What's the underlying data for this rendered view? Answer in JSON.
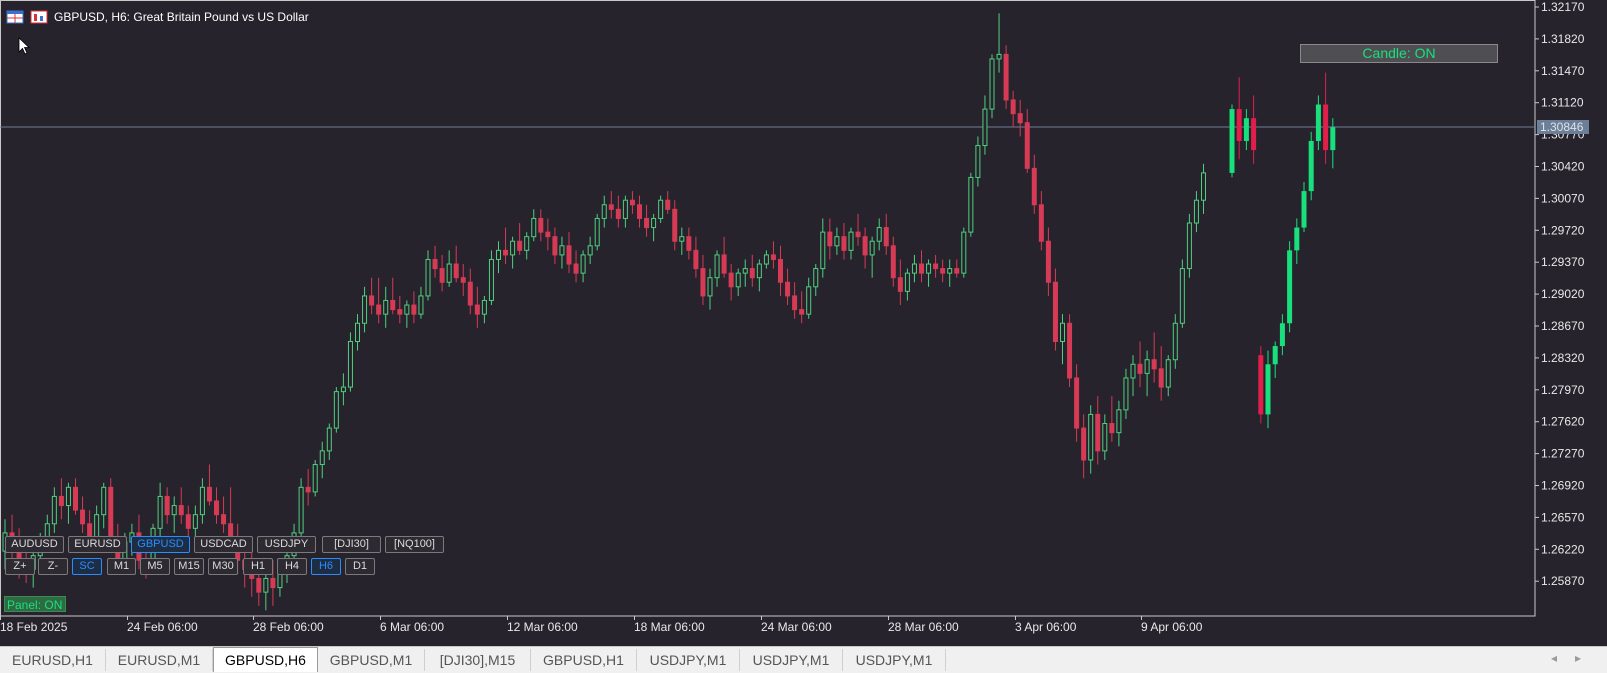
{
  "window": {
    "title": "GBPUSD, H6:  Great Britain Pound vs US Dollar"
  },
  "candle_toggle": "Candle: ON",
  "panel": {
    "symbols": [
      {
        "label": "AUDUSD",
        "active": false
      },
      {
        "label": "EURUSD",
        "active": false
      },
      {
        "label": "GBPUSD",
        "active": true
      },
      {
        "label": "USDCAD",
        "active": false
      },
      {
        "label": "USDJPY",
        "active": false
      },
      {
        "label": "[DJI30]",
        "active": false
      },
      {
        "label": "[NQ100]",
        "active": false
      }
    ],
    "timeframes": [
      {
        "label": "Z+",
        "active": false
      },
      {
        "label": "Z-",
        "active": false
      },
      {
        "label": "SC",
        "active": true
      },
      {
        "label": "M1",
        "active": false
      },
      {
        "label": "M5",
        "active": false
      },
      {
        "label": "M15",
        "active": false
      },
      {
        "label": "M30",
        "active": false
      },
      {
        "label": "H1",
        "active": false
      },
      {
        "label": "H4",
        "active": false
      },
      {
        "label": "H6",
        "active": true
      },
      {
        "label": "D1",
        "active": false
      }
    ],
    "toggle": "Panel: ON"
  },
  "tabs": [
    {
      "label": "EURUSD,H1",
      "active": false
    },
    {
      "label": "EURUSD,M1",
      "active": false
    },
    {
      "label": "GBPUSD,H6",
      "active": true
    },
    {
      "label": "GBPUSD,M1",
      "active": false
    },
    {
      "label": "[DJI30],M15",
      "active": false
    },
    {
      "label": "GBPUSD,H1",
      "active": false
    },
    {
      "label": "USDJPY,M1",
      "active": false
    },
    {
      "label": "USDJPY,M1",
      "active": false
    },
    {
      "label": "USDJPY,M1",
      "active": false
    }
  ],
  "colors": {
    "background": "#27232d",
    "bull": "#18e07c",
    "bear": "#e0204a",
    "bull_small": "#4fcf7e",
    "bear_small": "#d63a55",
    "axis_text": "#e8e8e8",
    "price_line": "#6b7f96"
  },
  "chart_data": {
    "type": "candlestick",
    "symbol": "GBPUSD",
    "timeframe": "H6",
    "y_ticks": [
      "1.32170",
      "1.31820",
      "1.31470",
      "1.31120",
      "1.30770",
      "1.30420",
      "1.30070",
      "1.29720",
      "1.29370",
      "1.29020",
      "1.28670",
      "1.28320",
      "1.27970",
      "1.27620",
      "1.27270",
      "1.26920",
      "1.26570",
      "1.26220",
      "1.25870"
    ],
    "ylim": [
      1.2552,
      1.3217
    ],
    "x_ticks": [
      "18 Feb 2025",
      "24 Feb 06:00",
      "28 Feb 06:00",
      "6 Mar 06:00",
      "12 Mar 06:00",
      "18 Mar 06:00",
      "24 Mar 06:00",
      "28 Mar 06:00",
      "3 Apr 06:00",
      "9 Apr 06:00"
    ],
    "current_price": "1.30846",
    "candles": [
      [
        1.262,
        1.2655,
        1.26,
        1.264
      ],
      [
        1.264,
        1.266,
        1.261,
        1.2625
      ],
      [
        1.2625,
        1.2645,
        1.259,
        1.261
      ],
      [
        1.261,
        1.263,
        1.2585,
        1.26
      ],
      [
        1.26,
        1.262,
        1.258,
        1.2615
      ],
      [
        1.2615,
        1.264,
        1.26,
        1.2635
      ],
      [
        1.2635,
        1.266,
        1.262,
        1.265
      ],
      [
        1.265,
        1.269,
        1.264,
        1.268
      ],
      [
        1.268,
        1.27,
        1.2655,
        1.267
      ],
      [
        1.267,
        1.2695,
        1.265,
        1.269
      ],
      [
        1.269,
        1.27,
        1.266,
        1.2665
      ],
      [
        1.2665,
        1.268,
        1.264,
        1.265
      ],
      [
        1.265,
        1.2665,
        1.262,
        1.263
      ],
      [
        1.263,
        1.267,
        1.2625,
        1.266
      ],
      [
        1.266,
        1.2695,
        1.2645,
        1.269
      ],
      [
        1.269,
        1.27,
        1.262,
        1.263
      ],
      [
        1.263,
        1.265,
        1.26,
        1.261
      ],
      [
        1.261,
        1.264,
        1.26,
        1.263
      ],
      [
        1.263,
        1.265,
        1.2615,
        1.264
      ],
      [
        1.264,
        1.266,
        1.26,
        1.261
      ],
      [
        1.261,
        1.263,
        1.259,
        1.26
      ],
      [
        1.26,
        1.265,
        1.2595,
        1.2645
      ],
      [
        1.2645,
        1.2695,
        1.2635,
        1.268
      ],
      [
        1.268,
        1.269,
        1.265,
        1.266
      ],
      [
        1.266,
        1.268,
        1.264,
        1.267
      ],
      [
        1.267,
        1.269,
        1.265,
        1.266
      ],
      [
        1.266,
        1.267,
        1.263,
        1.2645
      ],
      [
        1.2645,
        1.267,
        1.263,
        1.266
      ],
      [
        1.266,
        1.27,
        1.265,
        1.269
      ],
      [
        1.269,
        1.2715,
        1.267,
        1.2675
      ],
      [
        1.2675,
        1.269,
        1.265,
        1.266
      ],
      [
        1.266,
        1.268,
        1.264,
        1.265
      ],
      [
        1.265,
        1.269,
        1.262,
        1.263
      ],
      [
        1.263,
        1.265,
        1.2595,
        1.261
      ],
      [
        1.261,
        1.2625,
        1.258,
        1.26
      ],
      [
        1.26,
        1.262,
        1.257,
        1.259
      ],
      [
        1.259,
        1.261,
        1.256,
        1.2575
      ],
      [
        1.2575,
        1.26,
        1.2555,
        1.259
      ],
      [
        1.259,
        1.261,
        1.256,
        1.258
      ],
      [
        1.258,
        1.261,
        1.257,
        1.26
      ],
      [
        1.26,
        1.2625,
        1.2585,
        1.2615
      ],
      [
        1.2615,
        1.265,
        1.26,
        1.264
      ],
      [
        1.264,
        1.27,
        1.2635,
        1.269
      ],
      [
        1.269,
        1.271,
        1.267,
        1.2685
      ],
      [
        1.2685,
        1.272,
        1.268,
        1.2715
      ],
      [
        1.2715,
        1.274,
        1.27,
        1.273
      ],
      [
        1.273,
        1.276,
        1.272,
        1.2755
      ],
      [
        1.2755,
        1.28,
        1.275,
        1.2795
      ],
      [
        1.2795,
        1.2815,
        1.278,
        1.28
      ],
      [
        1.28,
        1.286,
        1.2795,
        1.285
      ],
      [
        1.285,
        1.288,
        1.284,
        1.287
      ],
      [
        1.287,
        1.291,
        1.286,
        1.29
      ],
      [
        1.29,
        1.292,
        1.288,
        1.289
      ],
      [
        1.289,
        1.292,
        1.287,
        1.288
      ],
      [
        1.288,
        1.291,
        1.2865,
        1.2895
      ],
      [
        1.2895,
        1.292,
        1.288,
        1.2885
      ],
      [
        1.2885,
        1.29,
        1.287,
        1.288
      ],
      [
        1.288,
        1.2895,
        1.2865,
        1.289
      ],
      [
        1.289,
        1.2905,
        1.287,
        1.288
      ],
      [
        1.288,
        1.291,
        1.2875,
        1.29
      ],
      [
        1.29,
        1.295,
        1.2895,
        1.294
      ],
      [
        1.294,
        1.2955,
        1.292,
        1.293
      ],
      [
        1.293,
        1.2945,
        1.2905,
        1.2915
      ],
      [
        1.2915,
        1.295,
        1.291,
        1.2935
      ],
      [
        1.2935,
        1.2955,
        1.2915,
        1.292
      ],
      [
        1.292,
        1.2935,
        1.29,
        1.2915
      ],
      [
        1.2915,
        1.293,
        1.288,
        1.289
      ],
      [
        1.289,
        1.291,
        1.2865,
        1.288
      ],
      [
        1.288,
        1.29,
        1.287,
        1.2895
      ],
      [
        1.2895,
        1.295,
        1.289,
        1.294
      ],
      [
        1.294,
        1.296,
        1.2925,
        1.295
      ],
      [
        1.295,
        1.2975,
        1.2935,
        1.2945
      ],
      [
        1.2945,
        1.2965,
        1.293,
        1.296
      ],
      [
        1.296,
        1.298,
        1.2945,
        1.295
      ],
      [
        1.295,
        1.297,
        1.294,
        1.2965
      ],
      [
        1.2965,
        1.2995,
        1.296,
        1.2985
      ],
      [
        1.2985,
        1.2995,
        1.296,
        1.297
      ],
      [
        1.297,
        1.2985,
        1.295,
        1.2965
      ],
      [
        1.2965,
        1.2975,
        1.2935,
        1.2945
      ],
      [
        1.2945,
        1.2965,
        1.293,
        1.2955
      ],
      [
        1.2955,
        1.297,
        1.2925,
        1.2935
      ],
      [
        1.2935,
        1.295,
        1.2915,
        1.2925
      ],
      [
        1.2925,
        1.295,
        1.2915,
        1.2945
      ],
      [
        1.2945,
        1.2965,
        1.2935,
        1.2955
      ],
      [
        1.2955,
        1.299,
        1.295,
        1.2985
      ],
      [
        1.2985,
        1.301,
        1.2975,
        1.3
      ],
      [
        1.3,
        1.3015,
        1.2985,
        1.2995
      ],
      [
        1.2995,
        1.301,
        1.2975,
        1.2985
      ],
      [
        1.2985,
        1.301,
        1.2975,
        1.3005
      ],
      [
        1.3005,
        1.3015,
        1.299,
        1.3
      ],
      [
        1.3,
        1.301,
        1.2975,
        1.2985
      ],
      [
        1.2985,
        1.3,
        1.2965,
        1.2975
      ],
      [
        1.2975,
        1.299,
        1.296,
        1.2985
      ],
      [
        1.2985,
        1.301,
        1.298,
        1.3005
      ],
      [
        1.3005,
        1.3015,
        1.299,
        1.2995
      ],
      [
        1.2995,
        1.3005,
        1.295,
        1.296
      ],
      [
        1.296,
        1.2975,
        1.2945,
        1.2965
      ],
      [
        1.2965,
        1.2975,
        1.294,
        1.295
      ],
      [
        1.295,
        1.2965,
        1.292,
        1.293
      ],
      [
        1.293,
        1.2945,
        1.289,
        1.29
      ],
      [
        1.29,
        1.293,
        1.2885,
        1.292
      ],
      [
        1.292,
        1.295,
        1.291,
        1.2945
      ],
      [
        1.2945,
        1.2965,
        1.292,
        1.2925
      ],
      [
        1.2925,
        1.2935,
        1.2895,
        1.291
      ],
      [
        1.291,
        1.293,
        1.29,
        1.2925
      ],
      [
        1.2925,
        1.294,
        1.291,
        1.293
      ],
      [
        1.293,
        1.2945,
        1.291,
        1.292
      ],
      [
        1.292,
        1.294,
        1.2905,
        1.2935
      ],
      [
        1.2935,
        1.295,
        1.293,
        1.2945
      ],
      [
        1.2945,
        1.296,
        1.293,
        1.294
      ],
      [
        1.294,
        1.2955,
        1.29,
        1.2915
      ],
      [
        1.2915,
        1.293,
        1.289,
        1.29
      ],
      [
        1.29,
        1.2915,
        1.2875,
        1.2885
      ],
      [
        1.2885,
        1.2905,
        1.287,
        1.288
      ],
      [
        1.288,
        1.292,
        1.2875,
        1.291
      ],
      [
        1.291,
        1.2935,
        1.29,
        1.293
      ],
      [
        1.293,
        1.2985,
        1.292,
        1.297
      ],
      [
        1.297,
        1.2985,
        1.294,
        1.2955
      ],
      [
        1.2955,
        1.2975,
        1.2945,
        1.2965
      ],
      [
        1.2965,
        1.298,
        1.294,
        1.295
      ],
      [
        1.295,
        1.2975,
        1.294,
        1.297
      ],
      [
        1.297,
        1.299,
        1.2955,
        1.2965
      ],
      [
        1.2965,
        1.2975,
        1.293,
        1.2945
      ],
      [
        1.2945,
        1.2965,
        1.292,
        1.296
      ],
      [
        1.296,
        1.2985,
        1.295,
        1.2975
      ],
      [
        1.2975,
        1.299,
        1.2945,
        1.2955
      ],
      [
        1.2955,
        1.2965,
        1.291,
        1.292
      ],
      [
        1.292,
        1.294,
        1.289,
        1.2905
      ],
      [
        1.2905,
        1.293,
        1.2895,
        1.2925
      ],
      [
        1.2925,
        1.2945,
        1.2915,
        1.2935
      ],
      [
        1.2935,
        1.295,
        1.2915,
        1.2925
      ],
      [
        1.2925,
        1.294,
        1.291,
        1.2935
      ],
      [
        1.2935,
        1.2945,
        1.292,
        1.293
      ],
      [
        1.293,
        1.294,
        1.2915,
        1.2925
      ],
      [
        1.2925,
        1.294,
        1.291,
        1.293
      ],
      [
        1.293,
        1.294,
        1.292,
        1.2925
      ],
      [
        1.2925,
        1.2975,
        1.292,
        1.297
      ],
      [
        1.297,
        1.3035,
        1.2965,
        1.303
      ],
      [
        1.303,
        1.3075,
        1.302,
        1.3065
      ],
      [
        1.3065,
        1.312,
        1.3055,
        1.3105
      ],
      [
        1.3105,
        1.3165,
        1.3095,
        1.316
      ],
      [
        1.316,
        1.321,
        1.3145,
        1.3165
      ],
      [
        1.3165,
        1.3175,
        1.3105,
        1.3115
      ],
      [
        1.3115,
        1.3125,
        1.3085,
        1.31
      ],
      [
        1.31,
        1.3115,
        1.3075,
        1.309
      ],
      [
        1.309,
        1.3105,
        1.3035,
        1.304
      ],
      [
        1.304,
        1.3055,
        1.299,
        1.3
      ],
      [
        1.3,
        1.3015,
        1.295,
        1.296
      ],
      [
        1.296,
        1.2975,
        1.29,
        1.2915
      ],
      [
        1.2915,
        1.293,
        1.284,
        1.285
      ],
      [
        1.285,
        1.288,
        1.2825,
        1.287
      ],
      [
        1.287,
        1.288,
        1.28,
        1.281
      ],
      [
        1.281,
        1.2825,
        1.274,
        1.2755
      ],
      [
        1.2755,
        1.277,
        1.27,
        1.272
      ],
      [
        1.272,
        1.278,
        1.2705,
        1.277
      ],
      [
        1.277,
        1.279,
        1.2715,
        1.273
      ],
      [
        1.273,
        1.277,
        1.272,
        1.276
      ],
      [
        1.276,
        1.279,
        1.274,
        1.275
      ],
      [
        1.275,
        1.2785,
        1.2735,
        1.2775
      ],
      [
        1.2775,
        1.282,
        1.2765,
        1.281
      ],
      [
        1.281,
        1.2835,
        1.279,
        1.2825
      ],
      [
        1.2825,
        1.285,
        1.28,
        1.2815
      ],
      [
        1.2815,
        1.284,
        1.279,
        1.283
      ],
      [
        1.283,
        1.286,
        1.2805,
        1.282
      ],
      [
        1.282,
        1.2845,
        1.2785,
        1.28
      ],
      [
        1.28,
        1.2835,
        1.279,
        1.283
      ],
      [
        1.283,
        1.288,
        1.282,
        1.287
      ],
      [
        1.287,
        1.294,
        1.2865,
        1.293
      ],
      [
        1.293,
        1.299,
        1.292,
        1.298
      ],
      [
        1.298,
        1.3015,
        1.297,
        1.3005
      ],
      [
        1.3005,
        1.3045,
        1.299,
        1.3035
      ],
      [
        1.3035,
        1.311,
        1.303,
        1.3105
      ],
      [
        1.3105,
        1.314,
        1.305,
        1.307
      ],
      [
        1.307,
        1.3105,
        1.306,
        1.3095
      ],
      [
        1.3095,
        1.312,
        1.3045,
        1.306
      ],
      [
        1.2835,
        1.2845,
        1.276,
        1.277
      ],
      [
        1.277,
        1.284,
        1.2755,
        1.2825
      ],
      [
        1.2825,
        1.285,
        1.281,
        1.2845
      ],
      [
        1.2845,
        1.288,
        1.2835,
        1.287
      ],
      [
        1.287,
        1.296,
        1.286,
        1.295
      ],
      [
        1.295,
        1.2985,
        1.2935,
        1.2975
      ],
      [
        1.2975,
        1.3025,
        1.297,
        1.3015
      ],
      [
        1.3015,
        1.308,
        1.3005,
        1.307
      ],
      [
        1.307,
        1.312,
        1.306,
        1.311
      ],
      [
        1.311,
        1.3145,
        1.3045,
        1.306
      ],
      [
        1.306,
        1.3095,
        1.304,
        1.3085
      ]
    ]
  }
}
